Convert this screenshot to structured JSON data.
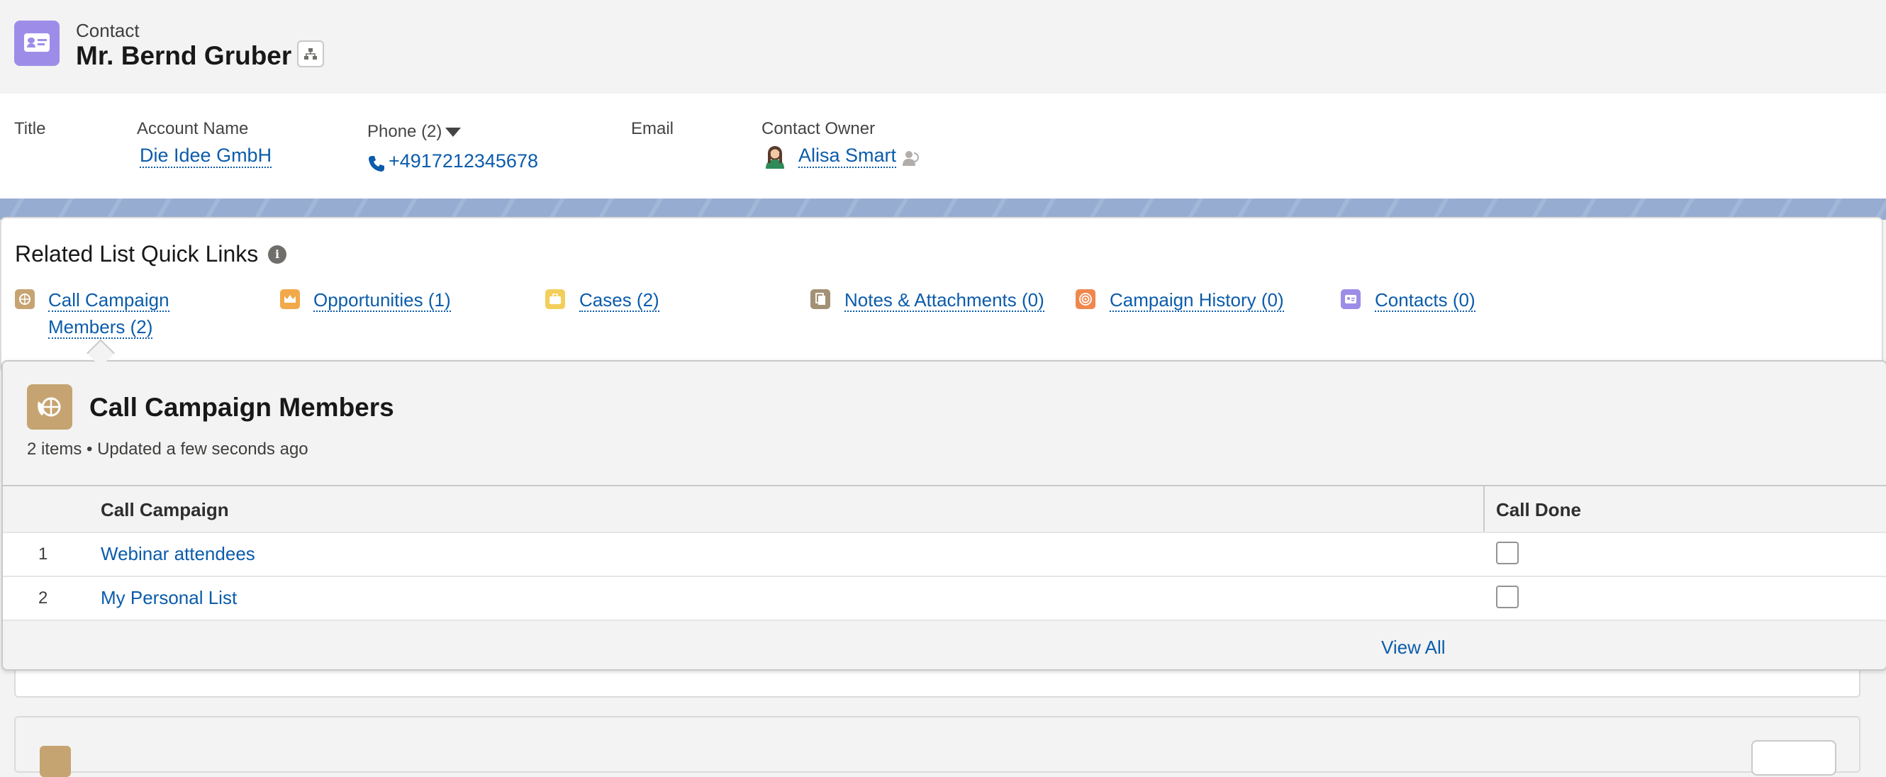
{
  "header": {
    "object_type": "Contact",
    "record_name": "Mr. Bernd Gruber",
    "record_icon": "contact-card-icon",
    "hierarchy_icon": "hierarchy-icon"
  },
  "highlights": {
    "title_label": "Title",
    "account_label": "Account Name",
    "account_value": "Die Idee GmbH",
    "phone_label": "Phone (2)",
    "phone_value": "+4917212345678",
    "email_label": "Email",
    "owner_label": "Contact Owner",
    "owner_value": "Alisa Smart"
  },
  "quick_links": {
    "title": "Related List Quick Links",
    "items": [
      {
        "line1": "Call Campaign",
        "line2": "Members (2)",
        "icon": "call-campaign-icon",
        "color": "#c6a472"
      },
      {
        "line1": "Opportunities (1)",
        "icon": "opportunity-crown-icon",
        "color": "#f2a94b"
      },
      {
        "line1": "Cases (2)",
        "icon": "case-briefcase-icon",
        "color": "#f2cf5b"
      },
      {
        "line1": "Notes & Attachments (0)",
        "icon": "notes-attachments-icon",
        "color": "#a39176"
      },
      {
        "line1": "Campaign History (0)",
        "icon": "campaign-target-icon",
        "color": "#f0874e"
      },
      {
        "line1": "Contacts (0)",
        "icon": "contact-card-icon",
        "color": "#9e8de8"
      }
    ]
  },
  "popover": {
    "title": "Call Campaign Members",
    "subtitle": "2 items • Updated a few seconds ago",
    "columns": [
      "Call Campaign",
      "Call Done"
    ],
    "rows": [
      {
        "num": "1",
        "campaign": "Webinar attendees",
        "done": false
      },
      {
        "num": "2",
        "campaign": "My Personal List",
        "done": false
      }
    ],
    "view_all": "View All"
  },
  "colors": {
    "link": "#0b5cab",
    "contact_icon": "#9e8de8",
    "call_campaign_icon": "#c6a472",
    "banner": "#97acd1"
  }
}
